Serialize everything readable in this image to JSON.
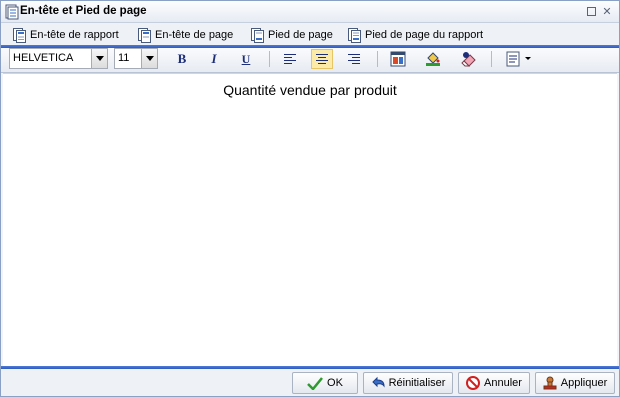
{
  "window": {
    "title": "En-tête et Pied de page"
  },
  "tabs": [
    {
      "label": "En-tête de rapport",
      "icon": "report-header-icon"
    },
    {
      "label": "En-tête de page",
      "icon": "page-header-icon"
    },
    {
      "label": "Pied de page",
      "icon": "page-footer-icon"
    },
    {
      "label": "Pied de page du rapport",
      "icon": "report-footer-icon"
    }
  ],
  "toolbar": {
    "font_family": "HELVETICA",
    "font_size": "11",
    "bold_label": "B",
    "italic_label": "I",
    "underline_label": "U",
    "active_alignment": "center"
  },
  "editor": {
    "content": "Quantité vendue par produit"
  },
  "footer": {
    "ok_label": "OK",
    "reset_label": "Réinitialiser",
    "cancel_label": "Annuler",
    "apply_label": "Appliquer"
  },
  "colors": {
    "accent_bar": "#2f5bbd",
    "active_button": "#fbeaa8",
    "ok_check": "#2e9b2e",
    "cancel_red": "#d21f1f"
  }
}
